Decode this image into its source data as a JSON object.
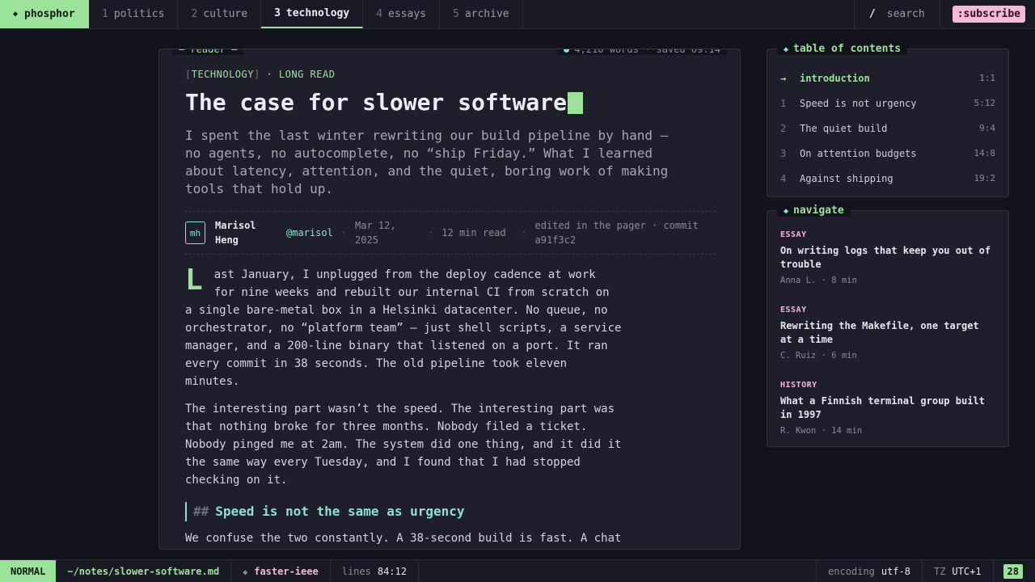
{
  "nav": {
    "brand": "phosphor",
    "tabs": [
      {
        "num": "1",
        "label": "politics"
      },
      {
        "num": "2",
        "label": "culture"
      },
      {
        "num": "3",
        "label": "technology"
      },
      {
        "num": "4",
        "label": "essays"
      },
      {
        "num": "5",
        "label": "archive"
      }
    ],
    "search_key": "/",
    "search_label": "search",
    "subscribe_label": ":subscribe"
  },
  "reader": {
    "label": "— reader —",
    "stats": "4,210 words · saved 09:14",
    "kicker_section": "TECHNOLOGY",
    "kicker_type": " · LONG READ",
    "title": "The case for slower software",
    "dek": "I spent the last winter rewriting our build pipeline by hand — no agents, no autocomplete, no “ship Friday.” What I learned about latency, attention, and the quiet, boring work of making tools that hold up.",
    "byline": {
      "initials": "mh",
      "author": "Marisol Heng",
      "handle": "@marisol",
      "date": "Mar 12, 2025",
      "read_time": "12 min read",
      "edited": "edited in the pager · commit a91f3c2"
    },
    "dropcap": "L",
    "para1": "ast January, I unplugged from the deploy cadence at work for nine weeks and rebuilt our internal CI from scratch on a single bare-metal box in a Helsinki datacenter. No queue, no orchestrator, no “platform team” — just shell scripts, a service manager, and a 200-line binary that listened on a port. It ran every commit in 38 seconds. The old pipeline took eleven minutes.",
    "para2": "The interesting part wasn’t the speed. The interesting part was that nothing broke for three months. Nobody filed a ticket. Nobody pinged me at 2am. The system did one thing, and it did it the same way every Tuesday, and I found that I had stopped checking on it.",
    "h2_hash": "##",
    "h2": "Speed is not the same as urgency",
    "para3": "We confuse the two constantly. A 38-second build is fast. A chat message saying “is the deploy done yet?” is a sort of fear."
  },
  "toc": {
    "label": "table of contents",
    "items": [
      {
        "n": "→",
        "t": "introduction",
        "pos": "1:1"
      },
      {
        "n": "1",
        "t": "Speed is not urgency",
        "pos": "5:12"
      },
      {
        "n": "2",
        "t": "The quiet build",
        "pos": "9:4"
      },
      {
        "n": "3",
        "t": "On attention budgets",
        "pos": "14:8"
      },
      {
        "n": "4",
        "t": "Against shipping",
        "pos": "19:2"
      }
    ]
  },
  "navigate": {
    "label": "navigate",
    "items": [
      {
        "tag": "ESSAY",
        "title": "On writing logs that keep you out of trouble",
        "meta": "Anna L. · 8 min"
      },
      {
        "tag": "ESSAY",
        "title": "Rewriting the Makefile, one target at a time",
        "meta": "C. Ruiz · 6 min"
      },
      {
        "tag": "HISTORY",
        "title": "What a Finnish terminal group built in 1997",
        "meta": "R. Kwon · 14 min"
      }
    ]
  },
  "status": {
    "mode": "NORMAL",
    "path": "~/notes/slower-software.md",
    "branch": "faster-ieee",
    "lines_label": "lines",
    "lines_value": "84:12",
    "encoding_label": "encoding",
    "encoding_value": "utf-8",
    "tz_label": "TZ",
    "tz_value": "UTC+1",
    "badge": "28"
  },
  "colors": {
    "accent_green": "#9be39b",
    "accent_cyan": "#8be0d6",
    "accent_pink": "#f5b8d8",
    "background": "#13131c",
    "panel": "#1f1f2b"
  }
}
